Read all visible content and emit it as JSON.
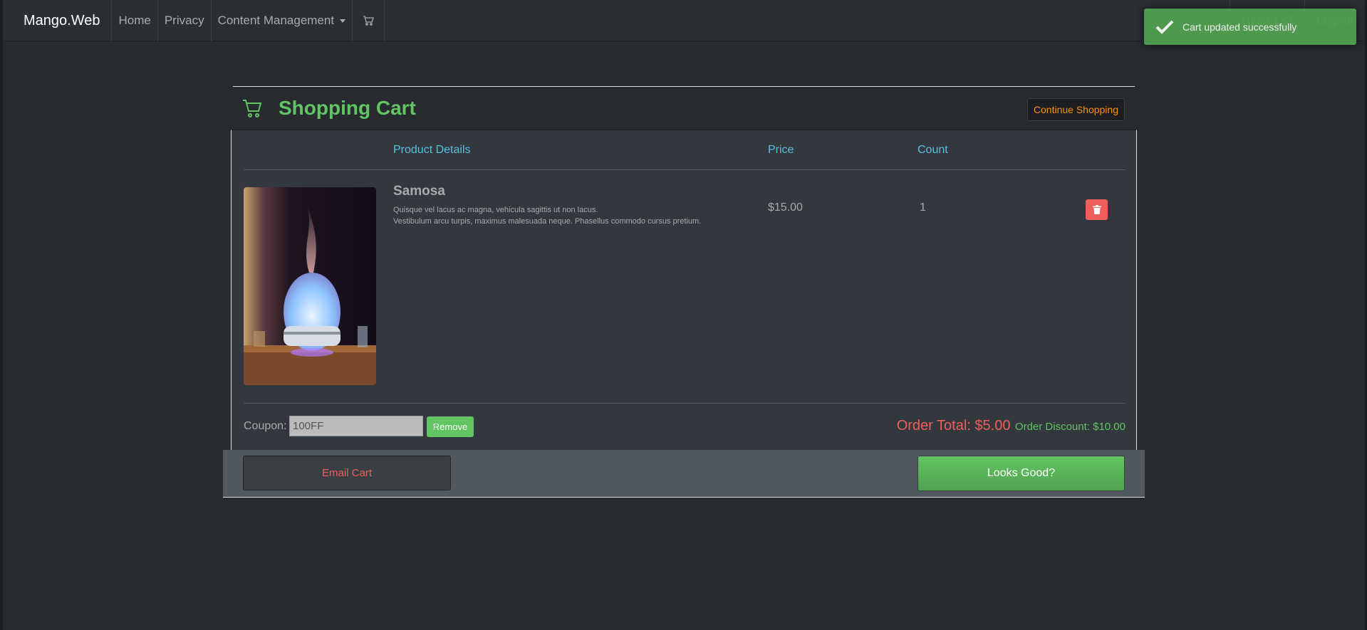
{
  "navbar": {
    "brand": "Mango.Web",
    "items": [
      "Home",
      "Privacy",
      "Content Management"
    ],
    "greeting": "Hello 123",
    "logout": "Logout"
  },
  "toast": {
    "message": "Cart updated successfully"
  },
  "cart": {
    "title": "Shopping Cart",
    "continue_label": "Continue Shopping",
    "columns": {
      "details": "Product Details",
      "price": "Price",
      "count": "Count"
    },
    "items": [
      {
        "name": "Samosa",
        "description_line1": "Quisque vel lacus ac magna, vehicula sagittis ut non lacus.",
        "description_line2": "Vestibulum arcu turpis, maximus malesuada neque. Phasellus commodo cursus pretium.",
        "price": "$15.00",
        "count": "1"
      }
    ],
    "coupon_label": "Coupon:",
    "coupon_value": "100FF",
    "remove_label": "Remove",
    "order_total": "Order Total: $5.00",
    "order_discount": "Order Discount: $10.00",
    "email_label": "Email Cart",
    "looks_good_label": "Looks Good?"
  },
  "colors": {
    "accent_green": "#62c462",
    "danger_red": "#ee5f5b",
    "info_blue": "#5bc0de",
    "warning_orange": "#f89406"
  }
}
